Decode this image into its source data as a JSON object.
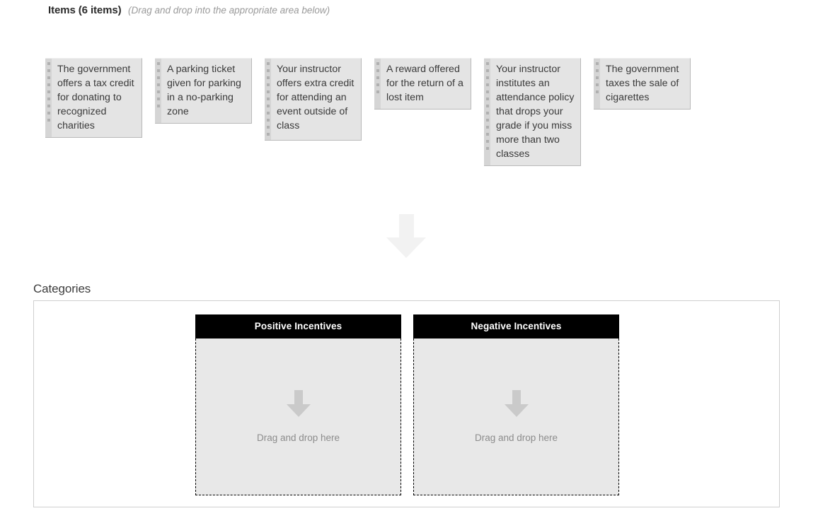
{
  "items_section": {
    "title": "Items (6 items)",
    "hint": "(Drag and drop into the appropriate area below)",
    "items": [
      {
        "text": "The government offers a tax credit for donating to recognized charities",
        "lines": 5
      },
      {
        "text": "A parking ticket given for parking in a no-parking zone",
        "lines": 4
      },
      {
        "text": "Your instructor offers extra credit for attending an event outside of class",
        "lines": 6
      },
      {
        "text": "A reward offered for the return of a lost item",
        "lines": 3
      },
      {
        "text": "Your instructor institutes an attendance policy that drops your grade if you miss more than two classes",
        "lines": 7
      },
      {
        "text": "The government taxes the sale of cigarettes",
        "lines": 3
      }
    ]
  },
  "flow": {
    "arrow_icon": "arrow-down-icon"
  },
  "categories_section": {
    "title": "Categories",
    "categories": [
      {
        "header": "Positive Incentives",
        "placeholder": "Drag and drop here",
        "arrow_icon": "arrow-down-icon",
        "items": []
      },
      {
        "header": "Negative Incentives",
        "placeholder": "Drag and drop here",
        "arrow_icon": "arrow-down-icon",
        "items": []
      }
    ]
  },
  "colors": {
    "card_background": "#e4e4e4",
    "card_border": "#b9b9b9",
    "grip_background": "#d5d5d5",
    "grip_dot": "#b0b0b0",
    "header_background": "#000000",
    "header_text": "#ffffff",
    "dropzone_background": "#e8e8e8",
    "dropzone_border": "#000000",
    "placeholder_text": "#8c8c8c",
    "flow_arrow": "#f2f2f2",
    "dropzone_arrow": "#cacaca",
    "panel_border": "#cfcfcf",
    "hint_text": "#9a9a9a"
  }
}
